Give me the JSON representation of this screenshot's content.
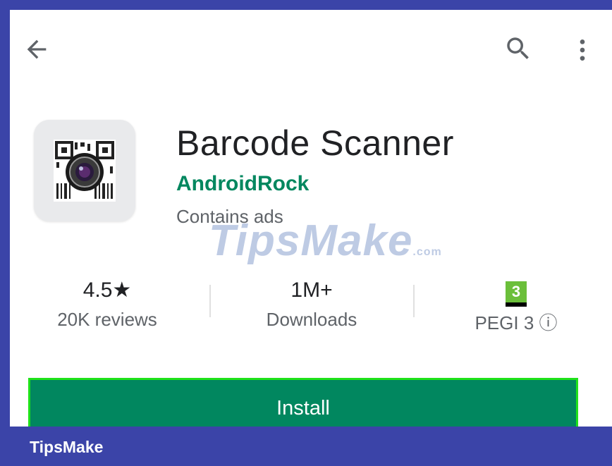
{
  "toolbar": {
    "back_icon": "arrow-left-icon",
    "search_icon": "search-icon",
    "more_icon": "more-vertical-icon"
  },
  "app": {
    "title": "Barcode Scanner",
    "developer": "AndroidRock",
    "notice": "Contains ads",
    "icon": "barcode-camera-app-icon"
  },
  "stats": {
    "rating_value": "4.5★",
    "rating_label": "20K reviews",
    "downloads_value": "1M+",
    "downloads_label": "Downloads",
    "pegi_badge": "3",
    "pegi_label": "PEGI 3 ⓘ"
  },
  "install": {
    "label": "Install"
  },
  "watermark": {
    "text": "TipsMake",
    "suffix": ".com"
  },
  "footer": {
    "brand": "TipsMake"
  },
  "colors": {
    "frame": "#3b44a8",
    "accent": "#01875f",
    "highlight": "#1fe21a",
    "pegi_green": "#6bbf3a"
  }
}
